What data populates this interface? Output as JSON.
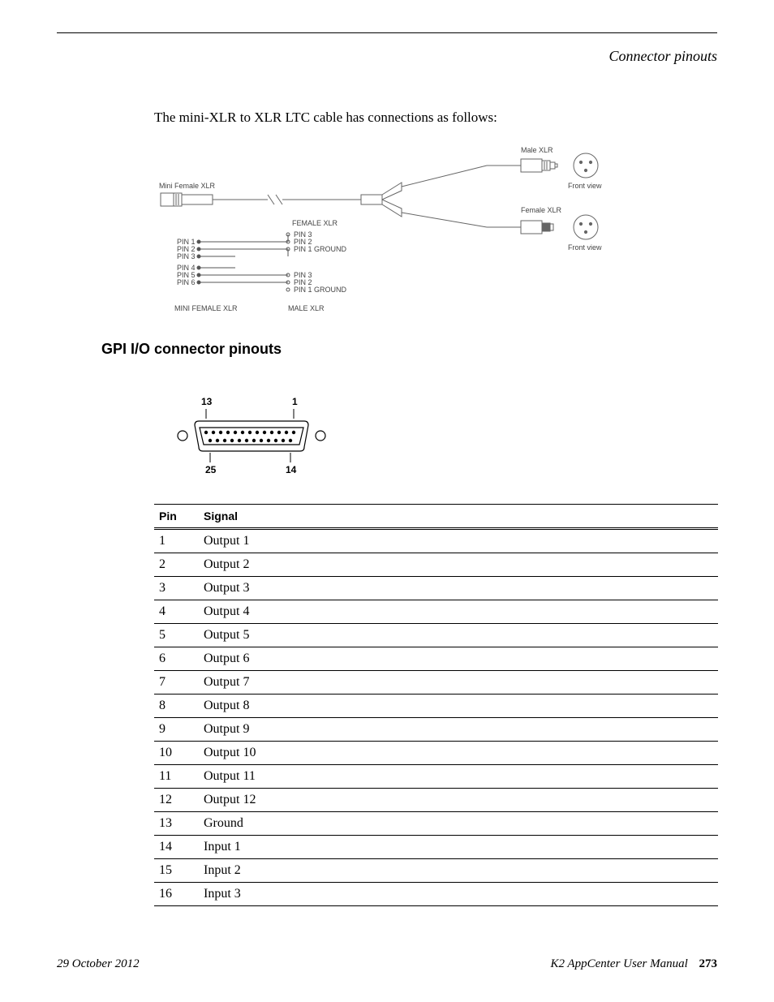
{
  "running_head": "Connector pinouts",
  "intro": "The mini-XLR to XLR LTC cable has connections as follows:",
  "diagram": {
    "mini_female_xlr_top": "Mini Female XLR",
    "female_xlr_mid": "FEMALE XLR",
    "male_xlr_top": "Male XLR",
    "female_xlr_right": "Female XLR",
    "front_view_1": "Front view",
    "front_view_2": "Front view",
    "mini_female_xlr_bottom": "MINI FEMALE XLR",
    "male_xlr_bottom": "MALE XLR",
    "pins_left": [
      "PIN 1",
      "PIN 2",
      "PIN 3",
      "PIN 4",
      "PIN 5",
      "PIN 6"
    ],
    "group1": [
      "PIN 3",
      "PIN 2",
      "PIN 1 GROUND"
    ],
    "group2": [
      "PIN 3",
      "PIN 2",
      "PIN 1 GROUND"
    ]
  },
  "section_heading": "GPI I/O connector pinouts",
  "connector_labels": {
    "tl": "13",
    "tr": "1",
    "bl": "25",
    "br": "14"
  },
  "table": {
    "headers": [
      "Pin",
      "Signal"
    ],
    "rows": [
      [
        "1",
        "Output 1"
      ],
      [
        "2",
        "Output 2"
      ],
      [
        "3",
        "Output 3"
      ],
      [
        "4",
        "Output 4"
      ],
      [
        "5",
        "Output 5"
      ],
      [
        "6",
        "Output 6"
      ],
      [
        "7",
        "Output 7"
      ],
      [
        "8",
        "Output 8"
      ],
      [
        "9",
        "Output 9"
      ],
      [
        "10",
        "Output 10"
      ],
      [
        "11",
        "Output 11"
      ],
      [
        "12",
        "Output 12"
      ],
      [
        "13",
        "Ground"
      ],
      [
        "14",
        "Input 1"
      ],
      [
        "15",
        "Input 2"
      ],
      [
        "16",
        "Input 3"
      ]
    ]
  },
  "footer": {
    "date": "29 October 2012",
    "manual": "K2 AppCenter User Manual",
    "page": "273"
  }
}
